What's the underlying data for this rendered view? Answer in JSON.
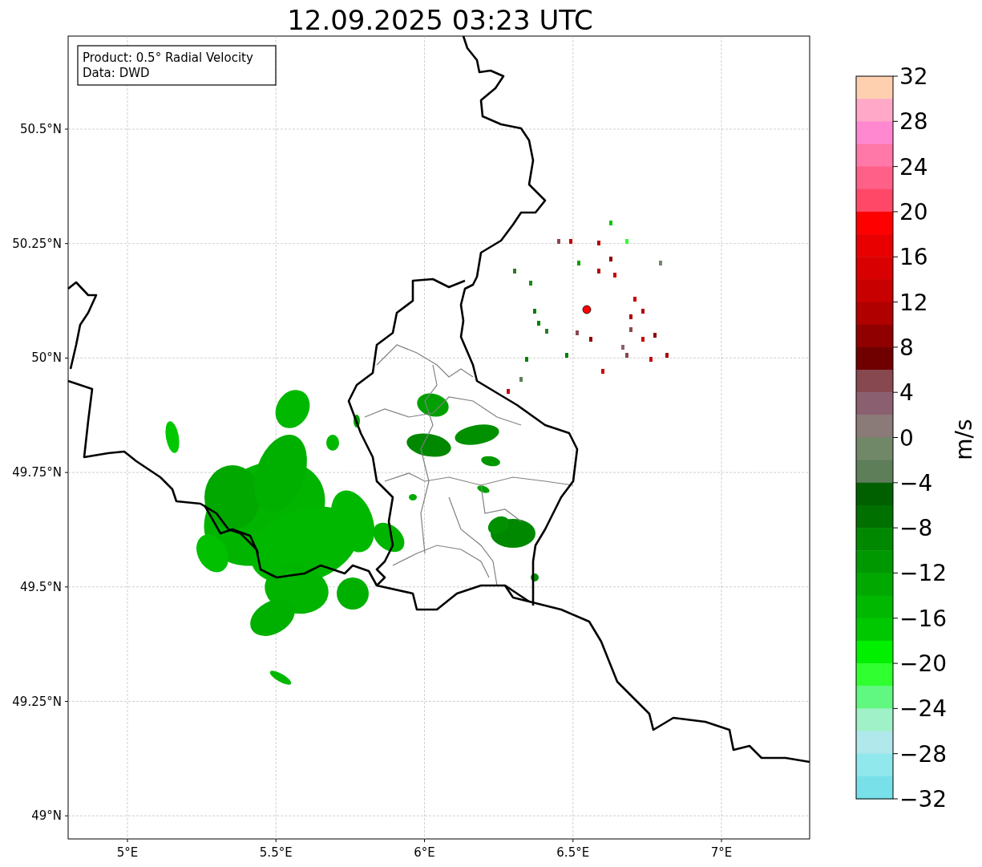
{
  "title": "12.09.2025 03:23 UTC",
  "info_box": {
    "lines": [
      "Product: 0.5° Radial Velocity",
      "Data: DWD"
    ]
  },
  "x_ticks": [
    "5°E",
    "5.5°E",
    "6°E",
    "6.5°E",
    "7°E"
  ],
  "y_ticks": [
    "50.5°N",
    "50.25°N",
    "50°N",
    "49.75°N",
    "49.5°N",
    "49.25°N",
    "49°N"
  ],
  "colorbar": {
    "unit": "m/s",
    "ticks": [
      "32",
      "28",
      "24",
      "20",
      "16",
      "12",
      "8",
      "4",
      "0",
      "−4",
      "−8",
      "−12",
      "−16",
      "−20",
      "−24",
      "−28",
      "−32"
    ],
    "segments": [
      {
        "color": "#ffd0b0"
      },
      {
        "color": "#ffa8c8"
      },
      {
        "color": "#ff88d0"
      },
      {
        "color": "#ff78a8"
      },
      {
        "color": "#ff6088"
      },
      {
        "color": "#ff4868"
      },
      {
        "color": "#ff0000"
      },
      {
        "color": "#e80000"
      },
      {
        "color": "#d80000"
      },
      {
        "color": "#c80000"
      },
      {
        "color": "#b00000"
      },
      {
        "color": "#900000"
      },
      {
        "color": "#700000"
      },
      {
        "color": "#884850"
      },
      {
        "color": "#8a6070"
      },
      {
        "color": "#8a7a78"
      },
      {
        "color": "#708868"
      },
      {
        "color": "#5e7e5a"
      },
      {
        "color": "#006000"
      },
      {
        "color": "#007000"
      },
      {
        "color": "#008800"
      },
      {
        "color": "#009800"
      },
      {
        "color": "#00a800"
      },
      {
        "color": "#00b800"
      },
      {
        "color": "#00c800"
      },
      {
        "color": "#00f000"
      },
      {
        "color": "#30ff30"
      },
      {
        "color": "#60f880"
      },
      {
        "color": "#a0f0c8"
      },
      {
        "color": "#b0e8ec"
      },
      {
        "color": "#90e8ec"
      },
      {
        "color": "#78e0e8"
      }
    ]
  }
}
